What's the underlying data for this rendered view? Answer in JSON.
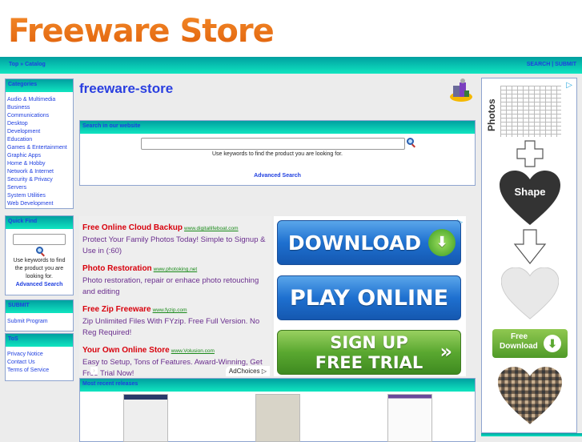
{
  "header": {
    "logo": "Freeware Store"
  },
  "nav": {
    "breadcrumb": "Top » Catalog",
    "search": "SEARCH",
    "sep": "|",
    "submit": "SUBMIT"
  },
  "sidebar": {
    "categories": {
      "title": "Categories",
      "items": [
        "Audio & Multimedia",
        "Business",
        "Communications",
        "Desktop",
        "Development",
        "Education",
        "Games & Entertainment",
        "Graphic Apps",
        "Home & Hobby",
        "Network & Internet",
        "Security & Privacy",
        "Servers",
        "System Utilities",
        "Web Development"
      ]
    },
    "quickfind": {
      "title": "Quick Find",
      "help": "Use keywords to find the product you are looking for.",
      "advanced": "Advanced Search",
      "value": ""
    },
    "submit": {
      "title": "SUBMIT",
      "items": [
        "Submit Program"
      ]
    },
    "tos": {
      "title": "ToS",
      "items": [
        "Privacy Notice",
        "Contact Us",
        "Terms of Service"
      ]
    }
  },
  "main": {
    "title": "freeware-store",
    "search": {
      "title": "Search in our website",
      "value": "",
      "help": "Use keywords to find the product you are looking for.",
      "advanced": "Advanced Search"
    },
    "text_ads": [
      {
        "title": "Free Online Cloud Backup",
        "url": "www.digitallifeboat.com",
        "desc": "Protect Your Family Photos Today! Simple to Signup & Use in (:60)"
      },
      {
        "title": "Photo Restoration",
        "url": "www.photoking.net",
        "desc": "Photo restoration, repair or enhace photo retouching and editing"
      },
      {
        "title": "Free Zip Freeware",
        "url": "www.fyzip.com",
        "desc": "Zip Unlimited Files With FYzip. Free Full Version. No Reg Required!"
      },
      {
        "title": "Your Own Online Store",
        "url": "www.Volusion.com",
        "desc": "Easy to Setup, Tons of Features. Award-Winning, Get Free Trial Now!"
      }
    ],
    "adchoices": "AdChoices",
    "button_ads": {
      "download": "DOWNLOAD",
      "play": "PLAY ONLINE",
      "signup1": "SIGN UP",
      "signup2": "FREE TRIAL"
    },
    "recent": {
      "title": "Most recent releases"
    }
  },
  "side_ad": {
    "photos": "Photos",
    "shape": "Shape",
    "free": "Free",
    "download": "Download"
  }
}
